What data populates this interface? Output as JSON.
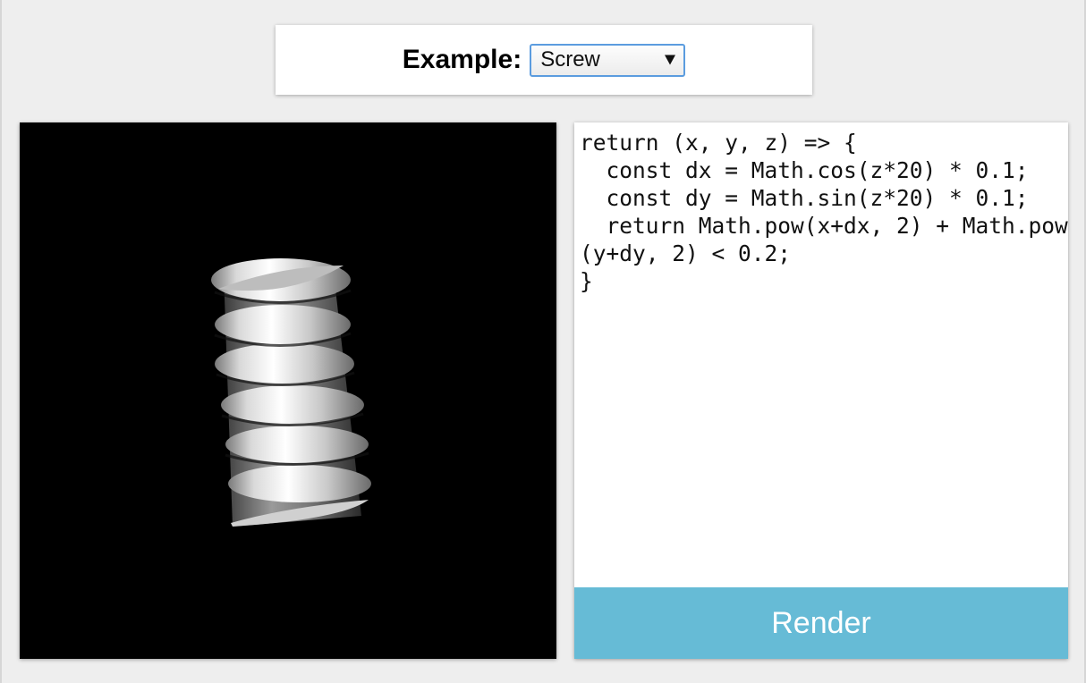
{
  "toolbar": {
    "example_label": "Example:",
    "example_selected": "Screw"
  },
  "viewport": {
    "object_icon": "screw-render"
  },
  "editor": {
    "code": "return (x, y, z) => {\n  const dx = Math.cos(z*20) * 0.1;\n  const dy = Math.sin(z*20) * 0.1;\n  return Math.pow(x+dx, 2) + Math.pow(y+dy, 2) < 0.2;\n}"
  },
  "render_button": {
    "label": "Render"
  },
  "colors": {
    "background": "#eeeeee",
    "accent_button": "#66bbd6",
    "select_border": "#5b9cdf",
    "viewport_background": "#000000"
  }
}
